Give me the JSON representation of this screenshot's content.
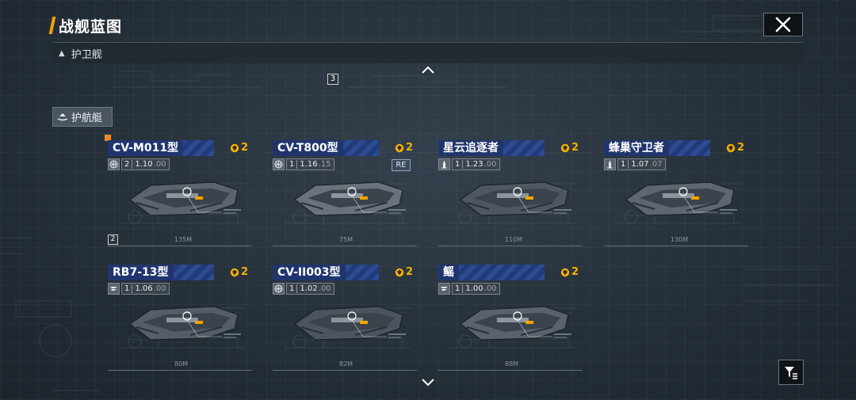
{
  "header": {
    "title": "战舰蓝图"
  },
  "class_bar": {
    "label": "护卫舰"
  },
  "sub_tab": {
    "label": "护航艇"
  },
  "top_tier_tag": "3",
  "colors": {
    "accent": "#f2a400",
    "name_bar": "#2d4b93",
    "cost": "#f2b400",
    "marker": "#f08a1a"
  },
  "ships": [
    {
      "name": "CV-M011型",
      "cost": "2",
      "type_icon": "globe-icon",
      "count": "2",
      "ratio_main": "1.10",
      "ratio_dim": ".00",
      "length": "135M",
      "tier": "2"
    },
    {
      "name": "CV-T800型",
      "cost": "2",
      "type_icon": "globe-icon",
      "count": "1",
      "ratio_main": "1.16",
      "ratio_dim": ".15",
      "length": "75M",
      "badge": "RE"
    },
    {
      "name": "星云追逐者",
      "cost": "2",
      "type_icon": "ship-icon",
      "count": "1",
      "ratio_main": "1.23",
      "ratio_dim": ".00",
      "length": "110M"
    },
    {
      "name": "蜂巢守卫者",
      "cost": "2",
      "type_icon": "ship-icon",
      "count": "1",
      "ratio_main": "1.07",
      "ratio_dim": ".07",
      "length": "130M"
    },
    {
      "name": "RB7-13型",
      "cost": "2",
      "type_icon": "wing-icon",
      "count": "1",
      "ratio_main": "1.06",
      "ratio_dim": ".00",
      "length": "80M"
    },
    {
      "name": "CV-II003型",
      "cost": "2",
      "type_icon": "globe-icon",
      "count": "1",
      "ratio_main": "1.02",
      "ratio_dim": ".00",
      "length": "82M"
    },
    {
      "name": "鳐",
      "cost": "2",
      "type_icon": "wing-icon",
      "count": "1",
      "ratio_main": "1.00",
      "ratio_dim": ".00",
      "length": "88M"
    }
  ]
}
